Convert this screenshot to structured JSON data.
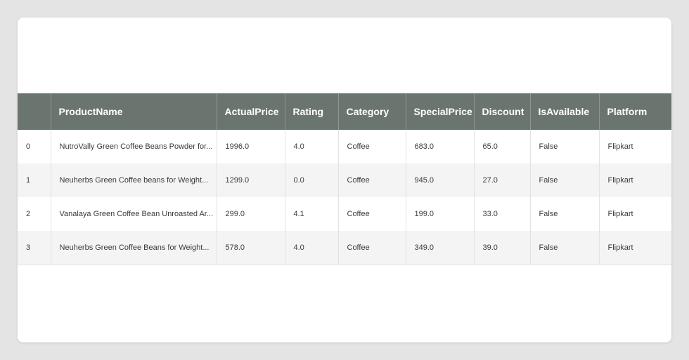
{
  "table": {
    "headers": [
      "",
      "ProductName",
      "ActualPrice",
      "Rating",
      "Category",
      "SpecialPrice",
      "Discount",
      "IsAvailable",
      "Platform"
    ],
    "rows": [
      [
        "0",
        "NutroVally Green Coffee Beans Powder for...",
        "1996.0",
        "4.0",
        "Coffee",
        "683.0",
        "65.0",
        "False",
        "Flipkart"
      ],
      [
        "1",
        "Neuherbs Green Coffee beans for Weight...",
        "1299.0",
        "0.0",
        "Coffee",
        "945.0",
        "27.0",
        "False",
        "Flipkart"
      ],
      [
        "2",
        "Vanalaya Green Coffee Bean Unroasted Ar...",
        "299.0",
        "4.1",
        "Coffee",
        "199.0",
        "33.0",
        "False",
        "Flipkart"
      ],
      [
        "3",
        "Neuherbs Green Coffee Beans for Weight...",
        "578.0",
        "4.0",
        "Coffee",
        "349.0",
        "39.0",
        "False",
        "Flipkart"
      ]
    ]
  },
  "colors": {
    "header_bg": "#6b7570",
    "header_text": "#ffffff",
    "row_alt_bg": "#f4f4f4",
    "page_bg": "#e4e4e4"
  }
}
